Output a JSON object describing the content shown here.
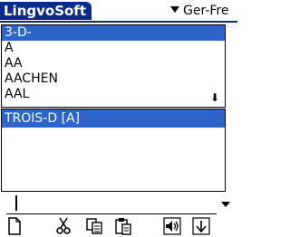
{
  "app": {
    "title": "LingvoSoft"
  },
  "language": {
    "selected": "Ger-Fre"
  },
  "wordlist": {
    "items": [
      "3-D-",
      "A",
      "AA",
      "AACHEN",
      "AAL"
    ],
    "selected_index": 0
  },
  "translation": {
    "text": "TROIS-D [A]"
  },
  "input": {
    "value": ""
  },
  "toolbar": {
    "icons": [
      "new-document-icon",
      "cut-icon",
      "copy-icon",
      "paste-icon",
      "speaker-icon",
      "scroll-down-icon"
    ]
  },
  "colors": {
    "title_bg": "#0a2b8a",
    "selection": "#2e63c9"
  }
}
